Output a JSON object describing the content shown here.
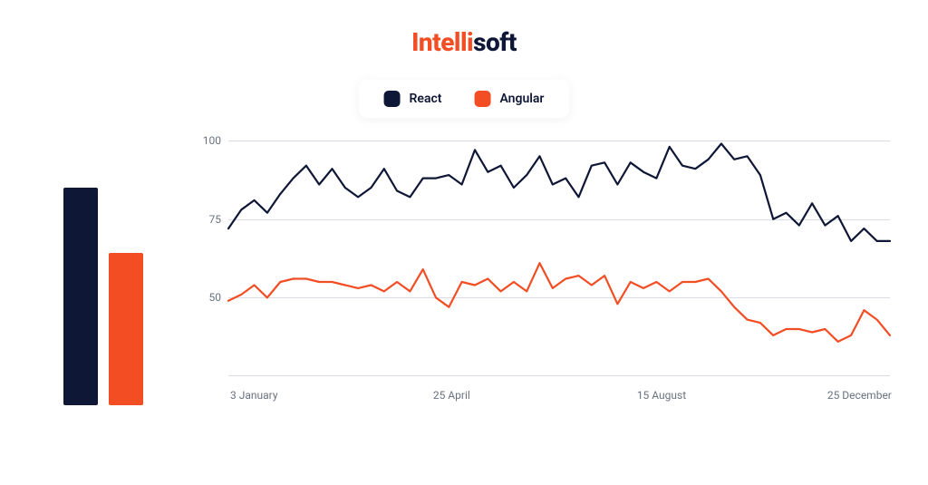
{
  "brand": {
    "part1": "Intelli",
    "part2": "soft"
  },
  "colors": {
    "react": "#0f1736",
    "angular": "#f24d23",
    "grid": "#d9dde3",
    "axis_text": "#6a7280"
  },
  "legend": {
    "items": [
      {
        "name": "React",
        "color_key": "react"
      },
      {
        "name": "Angular",
        "color_key": "angular"
      }
    ]
  },
  "bars": {
    "react_height": 240,
    "angular_height": 168
  },
  "chart_data": {
    "type": "line",
    "ylabel": "",
    "xlabel": "",
    "ylim": [
      25,
      100
    ],
    "y_ticks": [
      100,
      75,
      50
    ],
    "x_ticks": [
      "3 January",
      "25 April",
      "15 August",
      "25 December"
    ],
    "x_tick_positions": [
      0.01,
      0.315,
      0.625,
      0.915
    ],
    "x": [
      0,
      1,
      2,
      3,
      4,
      5,
      6,
      7,
      8,
      9,
      10,
      11,
      12,
      13,
      14,
      15,
      16,
      17,
      18,
      19,
      20,
      21,
      22,
      23,
      24,
      25,
      26,
      27,
      28,
      29,
      30,
      31,
      32,
      33,
      34,
      35,
      36,
      37,
      38,
      39,
      40,
      41,
      42,
      43,
      44,
      45,
      46,
      47,
      48,
      49,
      50,
      51
    ],
    "series": [
      {
        "name": "React",
        "color_key": "react",
        "values": [
          72,
          78,
          81,
          77,
          83,
          88,
          92,
          86,
          91,
          85,
          82,
          85,
          91,
          84,
          82,
          88,
          88,
          89,
          86,
          97,
          90,
          92,
          85,
          89,
          95,
          86,
          88,
          82,
          92,
          93,
          86,
          93,
          90,
          88,
          98,
          92,
          91,
          94,
          99,
          94,
          95,
          89,
          75,
          77,
          73,
          80,
          73,
          76,
          68,
          72,
          68,
          68
        ]
      },
      {
        "name": "Angular",
        "color_key": "angular",
        "values": [
          49,
          51,
          54,
          50,
          55,
          56,
          56,
          55,
          55,
          54,
          53,
          54,
          52,
          55,
          52,
          59,
          50,
          47,
          55,
          54,
          56,
          52,
          55,
          52,
          61,
          53,
          56,
          57,
          54,
          57,
          48,
          55,
          53,
          55,
          52,
          55,
          55,
          56,
          52,
          47,
          43,
          42,
          38,
          40,
          40,
          39,
          40,
          36,
          38,
          46,
          43,
          38
        ]
      }
    ]
  }
}
